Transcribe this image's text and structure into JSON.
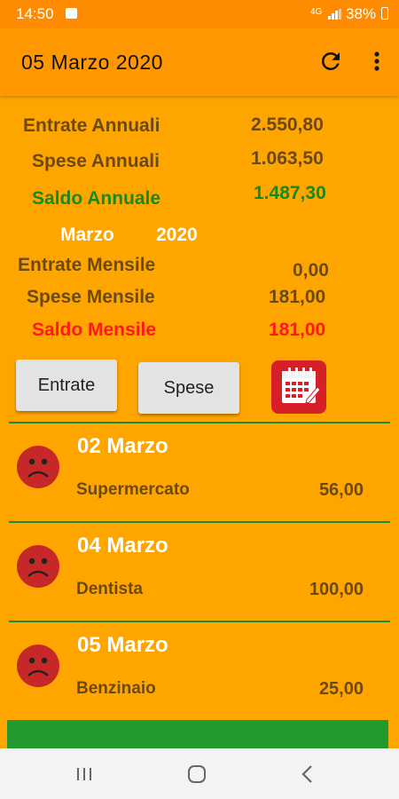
{
  "status_bar": {
    "time": "14:50",
    "signal": "4G",
    "battery": "38%"
  },
  "app_bar": {
    "title": "05  Marzo  2020",
    "refresh_icon": "refresh-icon",
    "menu_icon": "more-vert-icon"
  },
  "summary": {
    "annual_income_label": "Entrate Annuali",
    "annual_income_value": "2.550,80",
    "annual_expense_label": "Spese Annuali",
    "annual_expense_value": "1.063,50",
    "annual_balance_label": "Saldo Annuale",
    "annual_balance_value": "1.487,30",
    "month": "Marzo",
    "year": "2020",
    "monthly_income_label": "Entrate Mensile",
    "monthly_income_value": "0,00",
    "monthly_expense_label": "Spese Mensile",
    "monthly_expense_value": "181,00",
    "monthly_balance_label": "Saldo Mensile",
    "monthly_balance_value": "181,00"
  },
  "buttons": {
    "income": "Entrate",
    "expense": "Spese",
    "calendar_icon": "calendar-icon"
  },
  "entries": [
    {
      "date": "02  Marzo",
      "description": "Supermercato",
      "amount": "56,00",
      "icon": "sad-face-icon"
    },
    {
      "date": "04  Marzo",
      "description": "Dentista",
      "amount": "100,00",
      "icon": "sad-face-icon"
    },
    {
      "date": "05  Marzo",
      "description": "Benzinaio",
      "amount": "25,00",
      "icon": "sad-face-icon"
    }
  ],
  "colors": {
    "background": "#ffa500",
    "app_bar": "#ff9800",
    "positive": "#178a1b",
    "negative": "#ff1a1a",
    "divider": "#1f8a2a"
  }
}
